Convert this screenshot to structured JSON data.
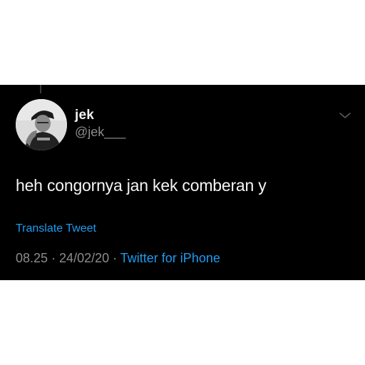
{
  "tweet": {
    "display_name": "jek",
    "handle": "@jek___",
    "text": "heh congornya jan kek comberan y",
    "translate_label": "Translate Tweet",
    "time": "08.25",
    "separator": " · ",
    "date": "24/02/20",
    "source": "Twitter for iPhone",
    "menu_icon": "chevron-down-icon",
    "avatar_icon": "avatar-photo"
  },
  "colors": {
    "background": "#000000",
    "link": "#1d9bf0",
    "secondary_text": "#8c8c8c",
    "primary_text": "#f5f5f5"
  }
}
